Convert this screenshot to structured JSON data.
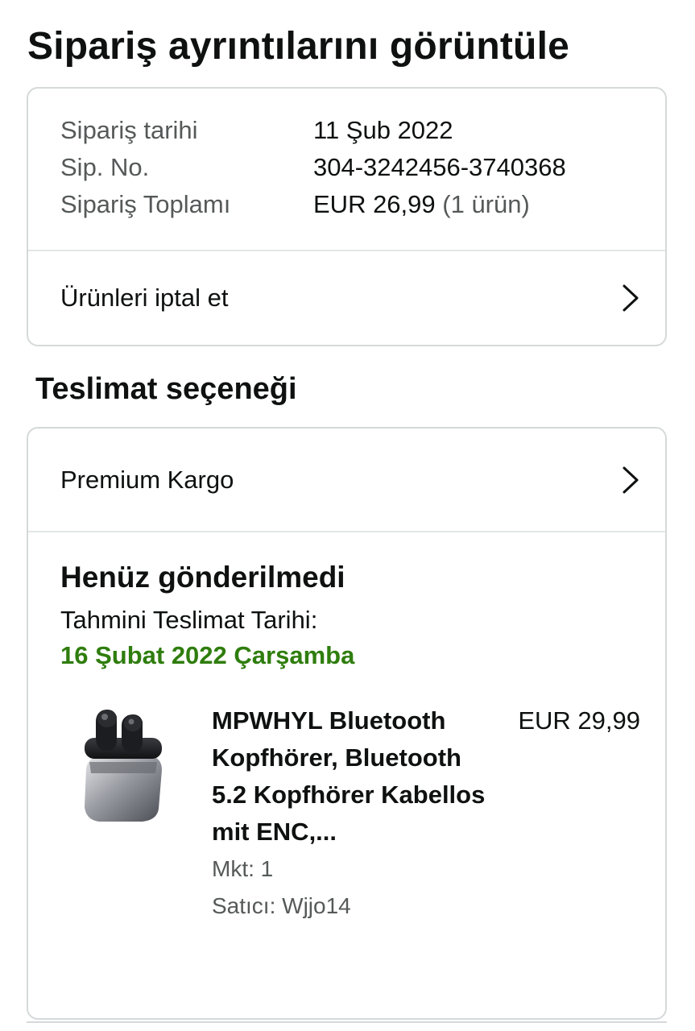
{
  "page": {
    "title": "Sipariş ayrıntılarını görüntüle"
  },
  "summary": {
    "rows": [
      {
        "label": "Sipariş tarihi",
        "value": "11 Şub 2022"
      },
      {
        "label": "Sip. No.",
        "value": "304-3242456-3740368"
      },
      {
        "label": "Sipariş Toplamı",
        "value": "EUR 26,99",
        "extra": "(1 ürün)"
      }
    ],
    "cancel_label": "Ürünleri iptal et"
  },
  "delivery": {
    "section_title": "Teslimat seçeneği",
    "option_label": "Premium Kargo",
    "status": "Henüz gönderilmedi",
    "eta_label": "Tahmini Teslimat Tarihi:",
    "eta_date": "16 Şubat 2022 Çarşamba",
    "eta_color": "#2f7d0e"
  },
  "product": {
    "title": "MPWHYL Bluetooth Kopfhörer, Bluetooth 5.2 Kopfhörer Kabellos mit ENC,...",
    "price": "EUR 29,99",
    "quantity": "Mkt: 1",
    "seller": "Satıcı: Wjjo14",
    "image_icon": "earbuds-case-icon"
  }
}
